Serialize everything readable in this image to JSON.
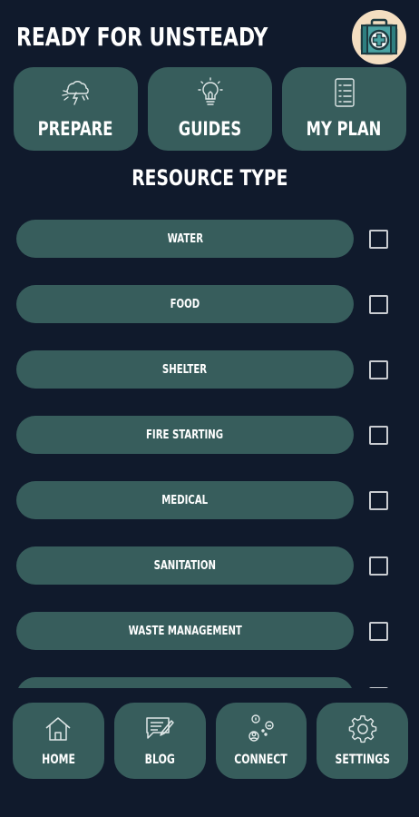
{
  "header": {
    "title": "READY FOR UNSTEADY",
    "kit_icon": "first-aid-kit-icon"
  },
  "top_tiles": [
    {
      "label": "PREPARE",
      "icon": "storm-icon"
    },
    {
      "label": "GUIDES",
      "icon": "lightbulb-icon"
    },
    {
      "label": "MY PLAN",
      "icon": "checklist-icon"
    }
  ],
  "section": {
    "title": "RESOURCE TYPE"
  },
  "resources": [
    {
      "label": "WATER",
      "checked": false
    },
    {
      "label": "FOOD",
      "checked": false
    },
    {
      "label": "SHELTER",
      "checked": false
    },
    {
      "label": "FIRE STARTING",
      "checked": false
    },
    {
      "label": "MEDICAL",
      "checked": false
    },
    {
      "label": "SANITATION",
      "checked": false
    },
    {
      "label": "WASTE MANAGEMENT",
      "checked": false
    }
  ],
  "bottom_nav": [
    {
      "label": "HOME",
      "icon": "home-icon"
    },
    {
      "label": "BLOG",
      "icon": "blog-icon"
    },
    {
      "label": "CONNECT",
      "icon": "connect-icon"
    },
    {
      "label": "SETTINGS",
      "icon": "gear-icon"
    }
  ],
  "colors": {
    "background": "#101a2c",
    "tile": "#375d5c",
    "kit_circle": "#f4dec1",
    "kit_teal": "#3a8c8c"
  }
}
